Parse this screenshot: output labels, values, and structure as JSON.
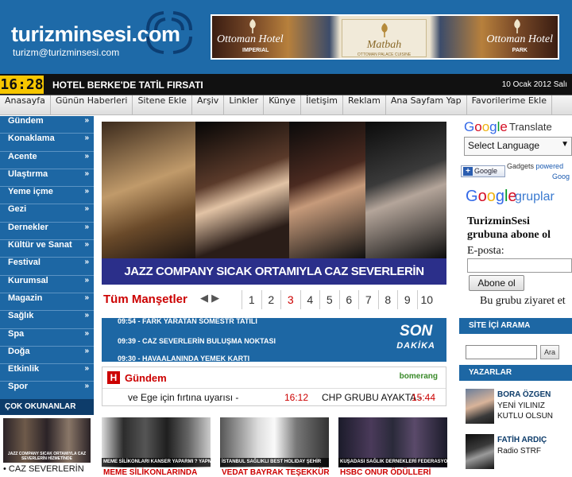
{
  "header": {
    "logo": "turizminsesi.com",
    "email": "turizm@turizminsesi.com",
    "banner": {
      "left_name": "Ottoman Hotel",
      "left_sub": "IMPERIAL",
      "mid_name": "Matbah",
      "mid_sub": "OTTOMAN PALACE CUISINE",
      "right_name": "Ottoman Hotel",
      "right_sub": "PARK"
    }
  },
  "ticker": {
    "clock": "16:28",
    "headline": "HOTEL BERKE'DE TATİL FIRSATI",
    "date": "10 Ocak 2012 Salı"
  },
  "nav": [
    "Anasayfa",
    "Günün Haberleri",
    "Sitene Ekle",
    "Arşiv",
    "Linkler",
    "Künye",
    "İletişim",
    "Reklam",
    "Ana Sayfam Yap",
    "Favorilerime Ekle"
  ],
  "left_menu": [
    "Gündem",
    "Konaklama",
    "Acente",
    "Ulaştırma",
    "Yeme içme",
    "Gezi",
    "Dernekler",
    "Kültür ve Sanat",
    "Festival",
    "Kurumsal",
    "Magazin",
    "Sağlık",
    "Spa",
    "Doğa",
    "Etkinlik",
    "Spor"
  ],
  "most_read": {
    "title": "ÇOK OKUNANLAR",
    "image_caption": "JAZZ COMPANY SICAK ORTAMIYLA CAZ SEVERLERİN HİZMETİNDE",
    "caption": "• CAZ SEVERLERİN"
  },
  "hero": {
    "title": "JAZZ COMPANY SICAK ORTAMIYLA CAZ SEVERLERİN HİZMETİNDE"
  },
  "manset": {
    "title": "Tüm Manşetler",
    "arrows": "◀ ▶",
    "pages": [
      "1",
      "2",
      "3",
      "4",
      "5",
      "6",
      "7",
      "8",
      "9",
      "10"
    ],
    "active_page": "3"
  },
  "son_dakika": {
    "label_top": "SON",
    "label_bottom": "DAKİKA",
    "items": [
      "09:54 - FARK YARATAN SOMESTR TATİLİ",
      "09:39 - CAZ SEVERLERİN BULUŞMA NOKTASI",
      "09:30 - HAVAALANINDA YEMEK KARTI"
    ]
  },
  "gundem": {
    "icon_letter": "H",
    "title": "Gündem",
    "partner": "bomerang",
    "line1_text": "ve Ege için fırtına uyarısı  -",
    "line1_time": "16:12",
    "line2_text": "CHP GRUBU AYAKTA  -",
    "line2_time": "15:44"
  },
  "thumbnails": [
    {
      "caption": "MEME SİLİKONLARI KANSER YAPARMI ? YAPMAZMI ?",
      "title": "MEME SİLİKONLARINDA"
    },
    {
      "caption": "İSTANBUL SAĞLIKLI BEST HOLIDAY ŞEHİR",
      "title": "VEDAT BAYRAK TEŞEKKÜR"
    },
    {
      "caption": "KUŞADASI SAĞLIK DERNEKLERİ FEDERASYONU ÖZEL VE ONUR ÖDÜLLERİ VERİLDİ",
      "title": "HSBC ONUR ÖDÜLLERİ"
    }
  ],
  "right": {
    "translate_word": "Translate",
    "select_language": "Select Language",
    "google_btn": "Google",
    "gadgets": "Gadgets",
    "powered": "powered",
    "by_google": "Goog",
    "groups_word": "gruplar",
    "group_name_1": "TurizminSesi",
    "group_name_2": "grubuna abone ol",
    "eposta": "E-posta:",
    "subscribe_btn": "Abone ol",
    "visit": "Bu grubu ziyaret et",
    "search_title": "SİTE İÇİ ARAMA",
    "search_btn": "Ara",
    "authors_title": "YAZARLAR",
    "authors": [
      {
        "name": "BORA ÖZGEN",
        "line1": "YENİ YILINIZ",
        "line2": "KUTLU OLSUN"
      },
      {
        "name": "FATİH ARDIÇ",
        "line1": "Radio STRF",
        "line2": ""
      }
    ]
  },
  "colors": {
    "header_blue": "#1e6aa8",
    "menu_blue": "#1d67a4",
    "hero_title_bg": "#2b2f8a",
    "accent_red": "#cc0000",
    "clock_yellow": "#f6c600"
  }
}
